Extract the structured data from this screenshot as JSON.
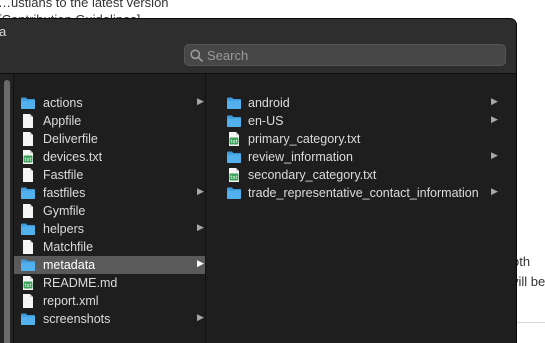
{
  "background": {
    "line1": "…ustians to the latest version",
    "line2": "[Contribution Guidelines]",
    "right1": "oth",
    "right2": "vill be"
  },
  "window": {
    "title": "a",
    "search_placeholder": "Search"
  },
  "column1": [
    {
      "label": "actions",
      "icon": "folder-icon",
      "chevron": true
    },
    {
      "label": "Appfile",
      "icon": "document-icon",
      "chevron": false
    },
    {
      "label": "Deliverfile",
      "icon": "document-icon",
      "chevron": false
    },
    {
      "label": "devices.txt",
      "icon": "text-file-icon",
      "chevron": false
    },
    {
      "label": "Fastfile",
      "icon": "document-icon",
      "chevron": false
    },
    {
      "label": "fastfiles",
      "icon": "folder-icon",
      "chevron": true
    },
    {
      "label": "Gymfile",
      "icon": "document-icon",
      "chevron": false
    },
    {
      "label": "helpers",
      "icon": "folder-icon",
      "chevron": true
    },
    {
      "label": "Matchfile",
      "icon": "document-icon",
      "chevron": false
    },
    {
      "label": "metadata",
      "icon": "folder-icon",
      "chevron": true,
      "selected": true
    },
    {
      "label": "README.md",
      "icon": "text-file-icon",
      "chevron": false
    },
    {
      "label": "report.xml",
      "icon": "document-icon",
      "chevron": false
    },
    {
      "label": "screenshots",
      "icon": "folder-icon",
      "chevron": true
    }
  ],
  "column2": [
    {
      "label": "android",
      "icon": "folder-icon",
      "chevron": true
    },
    {
      "label": "en-US",
      "icon": "folder-icon",
      "chevron": true
    },
    {
      "label": "primary_category.txt",
      "icon": "text-file-icon",
      "chevron": false
    },
    {
      "label": "review_information",
      "icon": "folder-icon",
      "chevron": true
    },
    {
      "label": "secondary_category.txt",
      "icon": "text-file-icon",
      "chevron": false
    },
    {
      "label": "trade_representative_contact_information",
      "icon": "folder-icon",
      "chevron": true
    }
  ],
  "chevron_glyph": "▶",
  "colors": {
    "folder": "#3d9bdc",
    "text_file_badge": "#3aa05a",
    "selection": "#5a5a5a"
  }
}
